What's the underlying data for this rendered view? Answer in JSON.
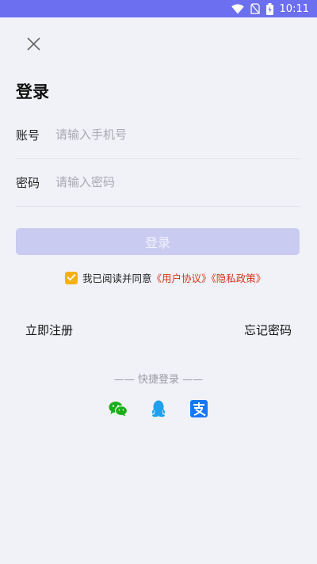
{
  "status_bar": {
    "time": "10:11"
  },
  "page": {
    "title": "登录"
  },
  "form": {
    "account": {
      "label": "账号",
      "placeholder": "请输入手机号",
      "value": ""
    },
    "password": {
      "label": "密码",
      "placeholder": "请输入密码",
      "value": ""
    },
    "login_label": "登录"
  },
  "agreement": {
    "checked": true,
    "prefix": "我已阅读并同意",
    "user_agreement": "《用户协议》",
    "privacy_policy": "《隐私政策》"
  },
  "links": {
    "register": "立即注册",
    "forgot": "忘记密码"
  },
  "quick_login": {
    "title": "—— 快捷登录 ——",
    "icons": [
      "wechat-icon",
      "qq-icon",
      "alipay-icon"
    ]
  },
  "colors": {
    "status_bar": "#6b6ff0",
    "login_button": "#c9cbf0",
    "checkbox": "#f6b10a",
    "link": "#d6351b",
    "wechat": "#1aad19",
    "qq": "#1ea0f0",
    "alipay": "#1677ff"
  }
}
